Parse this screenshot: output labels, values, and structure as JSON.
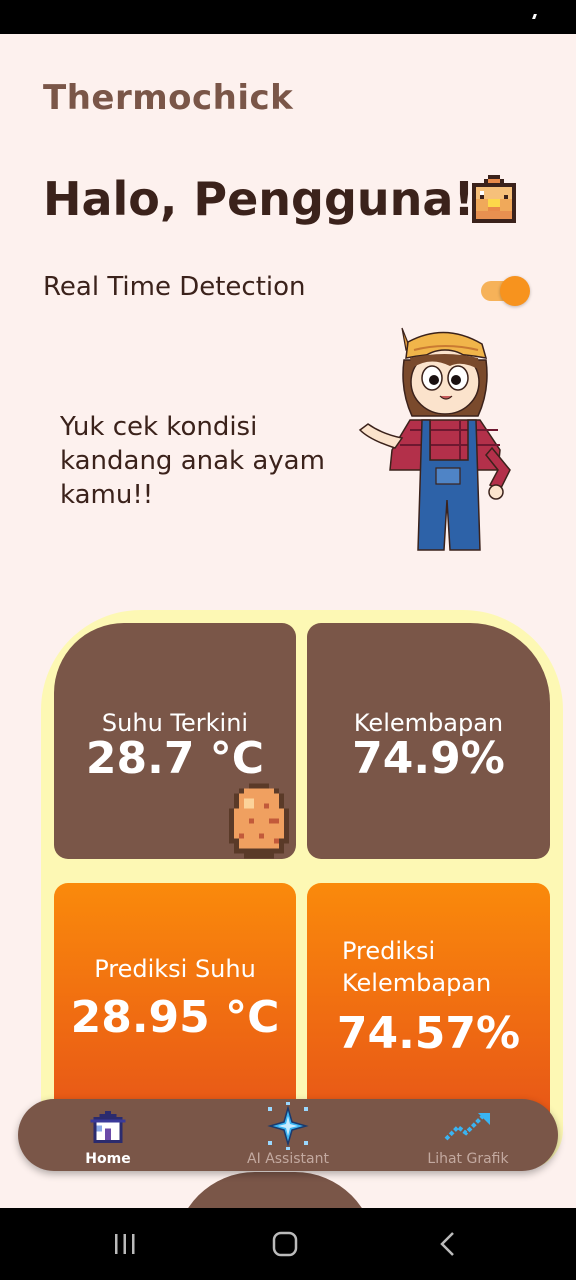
{
  "app": {
    "title": "Thermochick"
  },
  "header": {
    "greeting": "Halo, Pengguna!",
    "greeting_icon": "chick-icon"
  },
  "realtime": {
    "label": "Real Time Detection",
    "enabled": true
  },
  "promo": {
    "text": "Yuk cek kondisi kandang anak ayam kamu!!",
    "illustration": "farmer-girl-illustration"
  },
  "cards": {
    "current_temp": {
      "label": "Suhu Terkini",
      "value": "28.7 °C",
      "icon": "egg-icon"
    },
    "humidity": {
      "label": "Kelembapan",
      "value": "74.9%"
    },
    "pred_temp": {
      "label": "Prediksi Suhu",
      "value": "28.95 °C"
    },
    "pred_humidity": {
      "label": "Prediksi Kelembapan",
      "value": "74.57%"
    }
  },
  "nav": [
    {
      "label": "Home",
      "icon": "house-icon",
      "active": true
    },
    {
      "label": "AI Assistant",
      "icon": "sparkle-icon",
      "active": false
    },
    {
      "label": "Lihat Grafik",
      "icon": "trend-chart-icon",
      "active": false
    }
  ],
  "colors": {
    "background": "#fdf1ee",
    "brown": "#7a5648",
    "orange": "#f7931e",
    "panel": "#fdf8b4"
  }
}
